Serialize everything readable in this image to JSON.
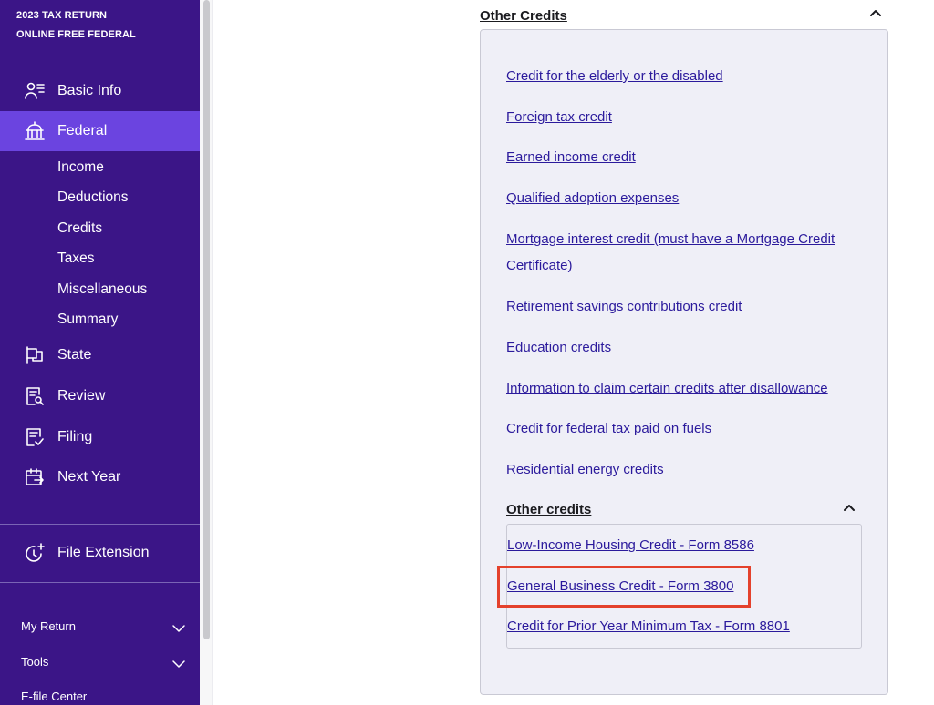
{
  "brand": {
    "line1": "2023 TAX RETURN",
    "line2": "ONLINE FREE FEDERAL"
  },
  "sidebar": {
    "items": [
      {
        "label": "Basic Info",
        "icon": "person-list-icon"
      },
      {
        "label": "Federal",
        "icon": "capitol-icon",
        "active": true
      },
      {
        "label": "State",
        "icon": "flag-icon"
      },
      {
        "label": "Review",
        "icon": "document-search-icon"
      },
      {
        "label": "Filing",
        "icon": "document-check-icon"
      },
      {
        "label": "Next Year",
        "icon": "calendar-arrow-icon"
      },
      {
        "label": "File Extension",
        "icon": "clock-plus-icon"
      }
    ],
    "federal_sub": [
      "Income",
      "Deductions",
      "Credits",
      "Taxes",
      "Miscellaneous",
      "Summary"
    ],
    "bottom": {
      "my_return": "My Return",
      "tools": "Tools",
      "efile_center": "E-file Center"
    }
  },
  "main": {
    "section_title": "Other Credits",
    "credits": [
      "Credit for the elderly or the disabled",
      "Foreign tax credit",
      "Earned income credit",
      "Qualified adoption expenses",
      "Mortgage interest credit (must have a Mortgage Credit Certificate)",
      "Retirement savings contributions credit",
      "Education credits",
      "Information to claim certain credits after disallowance",
      "Credit for federal tax paid on fuels",
      "Residential energy credits"
    ],
    "subsection_title": "Other credits",
    "other_credits": [
      "Low-Income Housing Credit - Form 8586",
      "General Business Credit - Form 3800",
      "Credit for Prior Year Minimum Tax - Form 8801"
    ]
  },
  "colors": {
    "sidebar_bg": "#3b1587",
    "active_bg": "#6b44e0",
    "link": "#2b1a9c",
    "highlight": "#e4412c"
  }
}
